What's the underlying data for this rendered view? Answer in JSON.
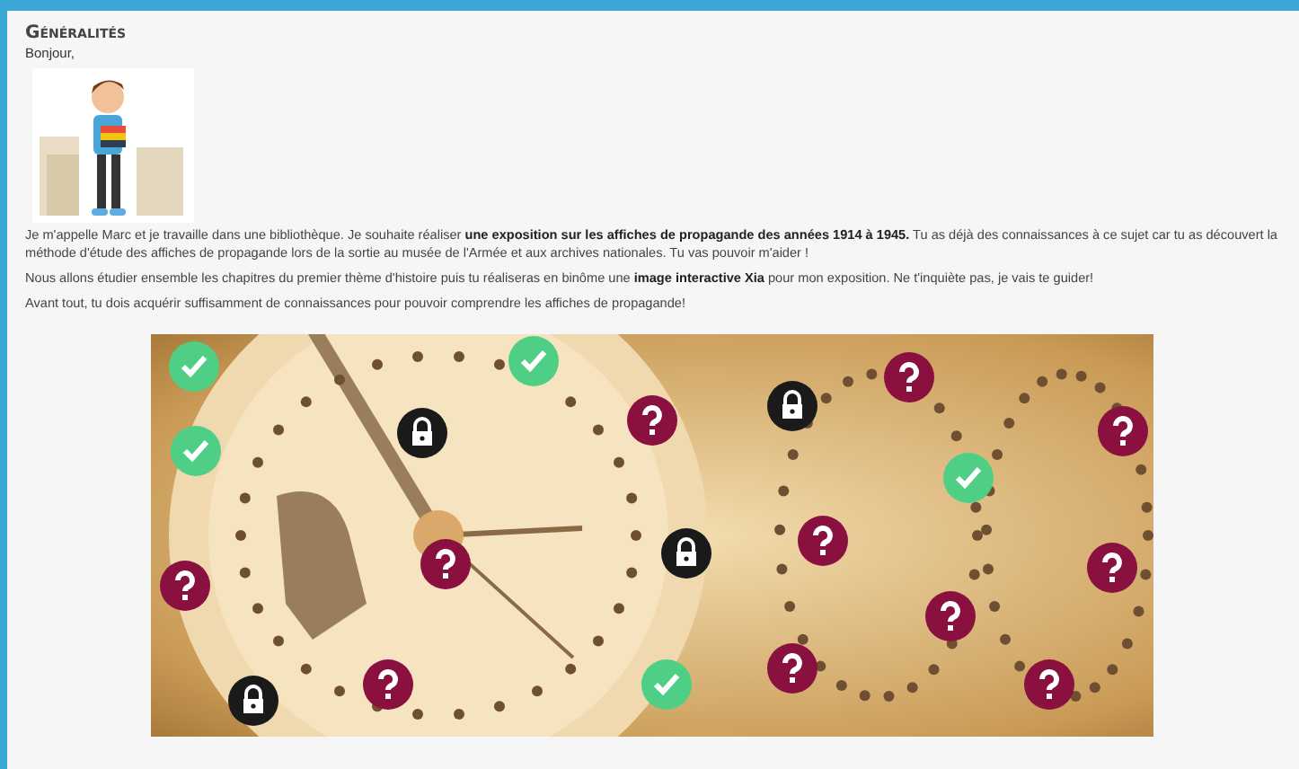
{
  "section": {
    "title": "Généralités",
    "greeting": "Bonjour,",
    "paragraphs": [
      "Je m'appelle Marc et je travaille dans une bibliothèque. Je souhaite réaliser **une exposition sur les affiches de propagande des années 1914 à 1945.** Tu as déjà des connaissances à ce sujet car tu as découvert la méthode d'étude des affiches de propagande lors de la sortie au musée de l'Armée et aux archives nationales. Tu vas pouvoir m'aider !",
      "Nous allons étudier ensemble les chapitres du premier thème d'histoire puis tu réaliseras en binôme une **image interactive Xia** pour mon exposition. Ne t'inquiète pas, je vais te guider!",
      "Avant tout, tu dois acquérir suffisamment de connaissances pour pouvoir comprendre les affiches de propagande!"
    ]
  },
  "interactive_image": {
    "markers": [
      {
        "kind": "done"
      },
      {
        "kind": "done"
      },
      {
        "kind": "done"
      },
      {
        "kind": "locked"
      },
      {
        "kind": "todo"
      },
      {
        "kind": "locked"
      },
      {
        "kind": "todo"
      },
      {
        "kind": "todo"
      },
      {
        "kind": "done"
      },
      {
        "kind": "locked"
      },
      {
        "kind": "todo"
      },
      {
        "kind": "todo"
      },
      {
        "kind": "todo"
      },
      {
        "kind": "todo"
      },
      {
        "kind": "todo"
      },
      {
        "kind": "todo"
      },
      {
        "kind": "locked"
      },
      {
        "kind": "done"
      },
      {
        "kind": "todo"
      },
      {
        "kind": "todo"
      }
    ]
  }
}
